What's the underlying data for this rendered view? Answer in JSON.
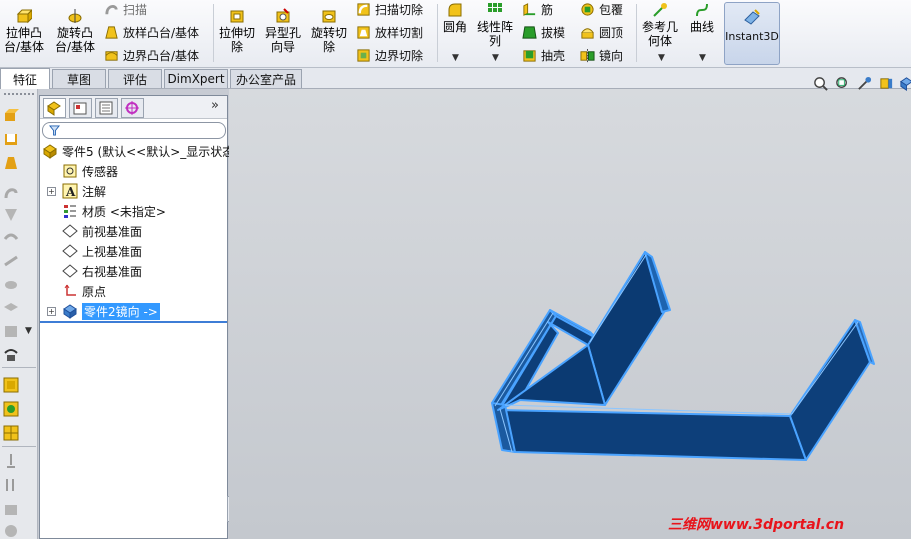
{
  "ribbon": {
    "extrude_boss": "拉伸凸\n台/基体",
    "revolve_boss": "旋转凸\n台/基体",
    "sweep": "扫描",
    "loft_boss": "放样凸台/基体",
    "boundary_boss": "边界凸台/基体",
    "extrude_cut": "拉伸切\n除",
    "hole_wizard": "异型孔\n向导",
    "revolve_cut": "旋转切\n除",
    "swept_cut": "扫描切除",
    "lofted_cut": "放样切割",
    "boundary_cut": "边界切除",
    "fillet": "圆角",
    "linear_pattern": "线性阵\n列",
    "rib": "筋",
    "draft": "拔模",
    "shell": "抽壳",
    "wrap": "包覆",
    "dome": "圆顶",
    "mirror": "镜向",
    "ref_geometry": "参考几\n何体",
    "curves": "曲线",
    "instant3d": "Instant3D"
  },
  "tabs": [
    "特征",
    "草图",
    "评估",
    "DimXpert",
    "办公室产品"
  ],
  "tree": {
    "root": "零件5 (默认<<默认>_显示状态",
    "items": [
      "传感器",
      "注解",
      "材质 <未指定>",
      "前视基准面",
      "上视基准面",
      "右视基准面",
      "原点",
      "零件2镜向 ->"
    ],
    "collapse_label": "»"
  },
  "watermark": "三维网www.3dportal.cn",
  "colors": {
    "accent": "#3399ff",
    "part_fill": "#0d3f7a",
    "part_edge": "#4aa3ff"
  }
}
